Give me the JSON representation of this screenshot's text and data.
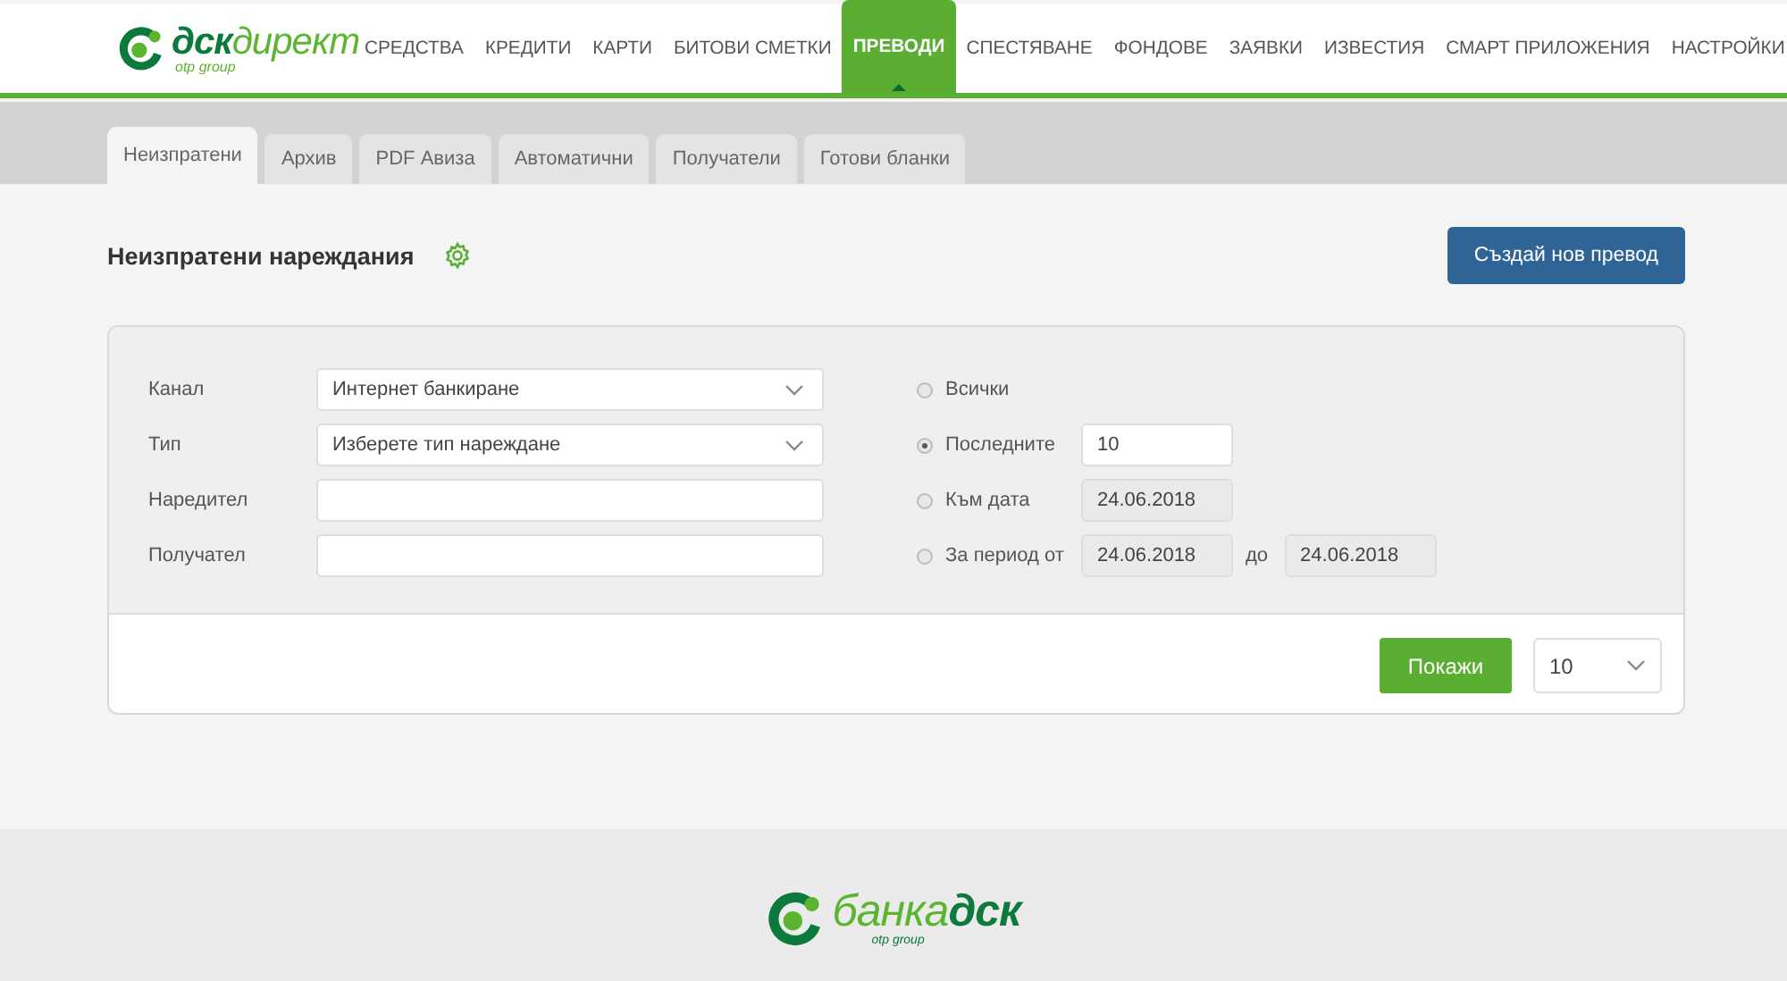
{
  "header": {
    "logo": {
      "brand_bold": "дск",
      "brand_light": "директ",
      "tagline": "otp group"
    },
    "nav": [
      {
        "label": "СРЕДСТВА",
        "selected": false
      },
      {
        "label": "КРЕДИТИ",
        "selected": false
      },
      {
        "label": "КАРТИ",
        "selected": false
      },
      {
        "label": "БИТОВИ СМЕТКИ",
        "selected": false
      },
      {
        "label": "ПРЕВОДИ",
        "selected": true
      },
      {
        "label": "СПЕСТЯВАНЕ",
        "selected": false
      },
      {
        "label": "ФОНДОВЕ",
        "selected": false
      },
      {
        "label": "ЗАЯВКИ",
        "selected": false
      },
      {
        "label": "ИЗВЕСТИЯ",
        "selected": false
      },
      {
        "label": "СМАРТ ПРИЛОЖЕНИЯ",
        "selected": false
      },
      {
        "label": "НАСТРОЙКИ",
        "selected": false
      }
    ]
  },
  "subtabs": [
    {
      "label": "Неизпратени",
      "selected": true
    },
    {
      "label": "Архив",
      "selected": false
    },
    {
      "label": "PDF Авиза",
      "selected": false
    },
    {
      "label": "Автоматични",
      "selected": false
    },
    {
      "label": "Получатели",
      "selected": false
    },
    {
      "label": "Готови бланки",
      "selected": false
    }
  ],
  "page": {
    "title": "Неизпратени нареждания",
    "create_button": "Създай нов превод"
  },
  "filter": {
    "fields": [
      {
        "kind": "select",
        "label": "Канал",
        "value": "Интернет банкиране"
      },
      {
        "kind": "select",
        "label": "Тип",
        "value": "Изберете тип нареждане"
      },
      {
        "kind": "text",
        "label": "Наредител"
      },
      {
        "kind": "text",
        "label": "Получател"
      }
    ],
    "periods": [
      {
        "label": "Всички",
        "selected": false
      },
      {
        "label": "Последните",
        "selected": true,
        "value": "10"
      },
      {
        "label": "Към дата",
        "selected": false,
        "value": "24.06.2018"
      },
      {
        "label": "За период от",
        "selected": false,
        "value": "24.06.2018",
        "separator": "до",
        "value_2": "24.06.2018"
      }
    ],
    "show_button": "Покажи",
    "page_size": "10"
  },
  "footer": {
    "logo": {
      "brand_light": "банка",
      "brand_bold": "дск",
      "tagline": "otp group"
    }
  }
}
